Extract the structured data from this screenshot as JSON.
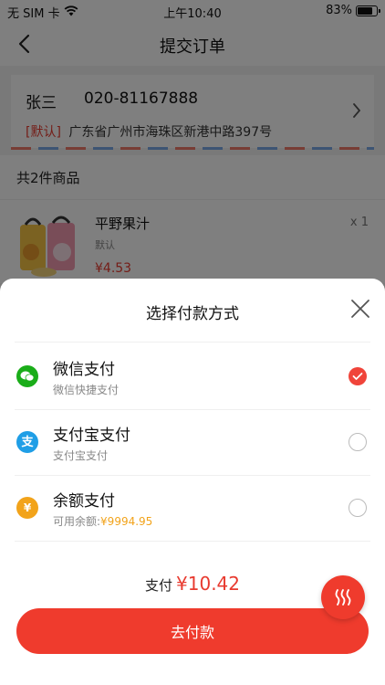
{
  "status_bar": {
    "carrier": "无 SIM 卡",
    "time": "上午10:40",
    "battery": "83%",
    "battery_level": 0.83
  },
  "nav": {
    "title": "提交订单"
  },
  "address": {
    "name": "张三",
    "phone": "020-81167888",
    "default_tag": "[默认]",
    "detail": "广东省广州市海珠区新港中路397号"
  },
  "goods": {
    "count_label": "共2件商品",
    "items": [
      {
        "name": "平野果汁",
        "spec": "默认",
        "price": "¥4.53",
        "qty": "x 1"
      }
    ]
  },
  "payment_sheet": {
    "title": "选择付款方式",
    "methods": [
      {
        "name": "微信支付",
        "desc": "微信快捷支付",
        "selected": true,
        "icon": "wechat-icon"
      },
      {
        "name": "支付宝支付",
        "desc": "支付宝支付",
        "selected": false,
        "icon": "alipay-icon"
      },
      {
        "name": "余额支付",
        "desc_prefix": "可用余额:",
        "balance": "¥9994.95",
        "selected": false,
        "icon": "wallet-icon"
      }
    ],
    "total_label": "支付",
    "total_amount": "¥10.42",
    "pay_button": "去付款"
  },
  "colors": {
    "accent": "#ef3b2d",
    "wechat": "#1aad19",
    "alipay": "#1f9ee6",
    "balance": "#f2a31a"
  }
}
